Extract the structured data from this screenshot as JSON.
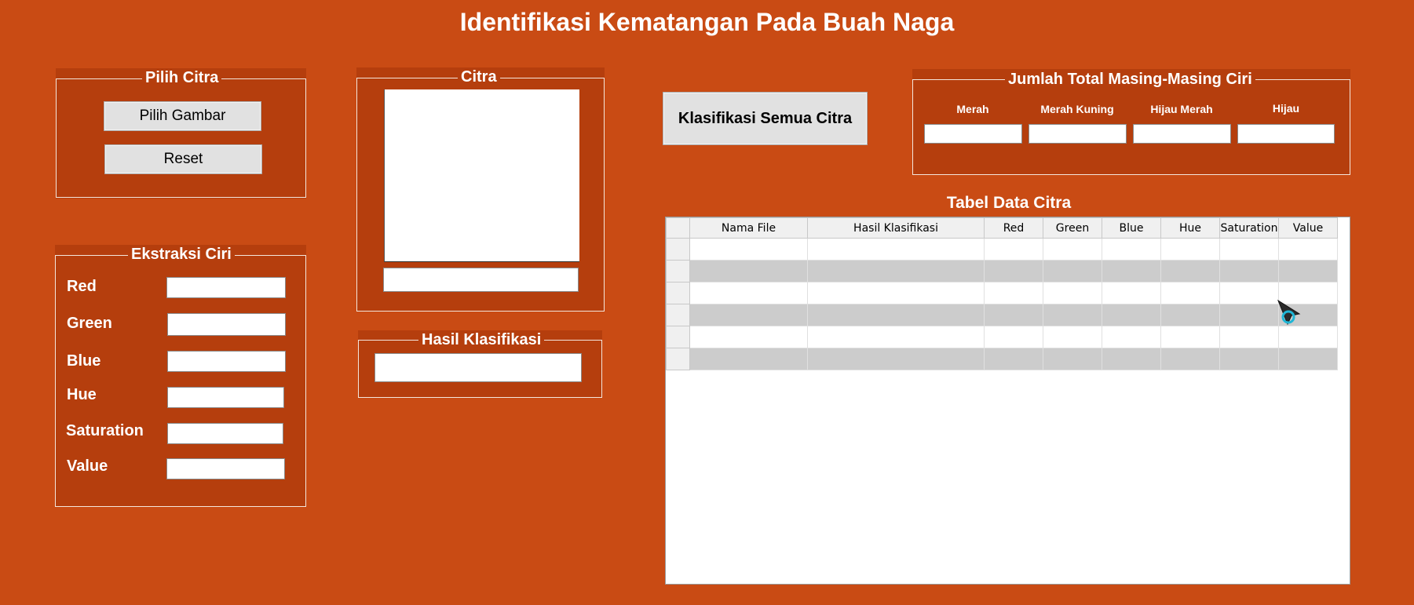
{
  "app": {
    "title": "Identifikasi Kematangan Pada Buah Naga"
  },
  "pilih_citra": {
    "legend": "Pilih Citra",
    "pilih_button": "Pilih Gambar",
    "reset_button": "Reset"
  },
  "ekstraksi": {
    "legend": "Ekstraksi Ciri",
    "fields": [
      {
        "label": "Red",
        "value": ""
      },
      {
        "label": "Green",
        "value": ""
      },
      {
        "label": "Blue",
        "value": ""
      },
      {
        "label": "Hue",
        "value": ""
      },
      {
        "label": "Saturation",
        "value": ""
      },
      {
        "label": "Value",
        "value": ""
      }
    ]
  },
  "citra": {
    "legend": "Citra",
    "filename": ""
  },
  "hasil": {
    "legend": "Hasil Klasifikasi",
    "value": ""
  },
  "klasifikasi_button": "Klasifikasi Semua Citra",
  "jumlah": {
    "legend": "Jumlah Total Masing-Masing Ciri",
    "columns": [
      {
        "label": "Merah",
        "value": ""
      },
      {
        "label": "Merah Kuning",
        "value": ""
      },
      {
        "label": "Hijau Merah",
        "value": ""
      },
      {
        "label": "Hijau",
        "value": ""
      }
    ]
  },
  "table": {
    "title": "Tabel Data Citra",
    "columns": [
      "Nama File",
      "Hasil Klasifikasi",
      "Red",
      "Green",
      "Blue",
      "Hue",
      "Saturation",
      "Value"
    ],
    "rows": [
      [
        "",
        "",
        "",
        "",
        "",
        "",
        "",
        ""
      ],
      [
        "",
        "",
        "",
        "",
        "",
        "",
        "",
        ""
      ],
      [
        "",
        "",
        "",
        "",
        "",
        "",
        "",
        ""
      ],
      [
        "",
        "",
        "",
        "",
        "",
        "",
        "",
        ""
      ],
      [
        "",
        "",
        "",
        "",
        "",
        "",
        "",
        ""
      ],
      [
        "",
        "",
        "",
        "",
        "",
        "",
        "",
        ""
      ]
    ]
  },
  "colors": {
    "background": "#c94b14",
    "panel": "#b53e0d",
    "row_alt": "#cccccc",
    "cursor_ring": "#1fb6d6"
  }
}
